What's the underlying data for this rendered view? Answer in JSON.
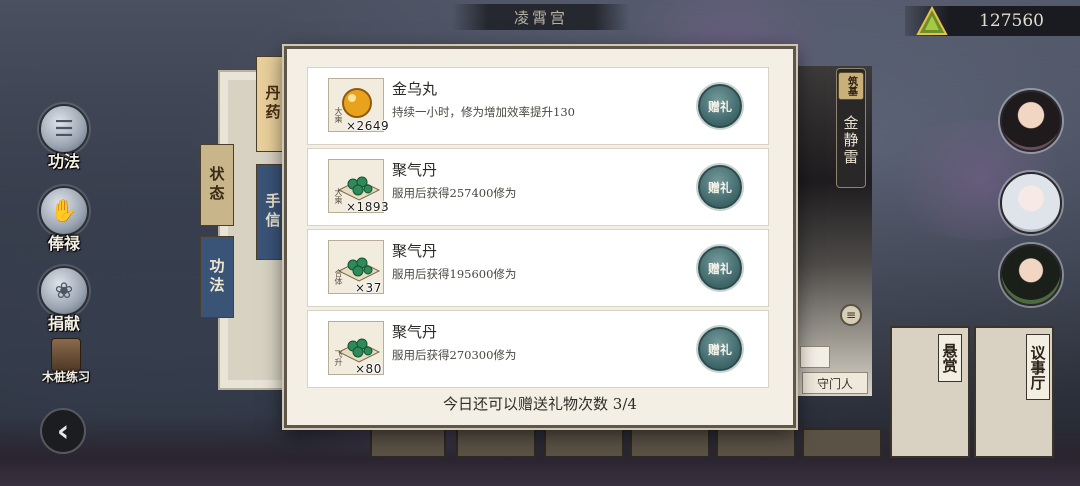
{
  "location": {
    "title": "凌霄宫"
  },
  "currency": {
    "amount": "127560",
    "icon": "jade-currency-icon"
  },
  "left_menu": [
    {
      "label": "功法",
      "icon": "scroll-icon"
    },
    {
      "label": "俸禄",
      "icon": "salary-hand-icon"
    },
    {
      "label": "捐献",
      "icon": "donate-bag-icon"
    }
  ],
  "wood_training": {
    "label": "木桩练习",
    "icon": "wooden-dummy-icon"
  },
  "back_button": {
    "glyph": "‹",
    "icon": "back-arrow-icon"
  },
  "side_tabs": {
    "pill_tab": "丹药",
    "letter_tab": "手信",
    "status_tab": "状态",
    "skill_tab": "功法"
  },
  "character": {
    "rank_badge": "筑基",
    "name": "金静雷",
    "guard_label": "守门人"
  },
  "boards": [
    {
      "title": "悬赏"
    },
    {
      "title": "议事厅"
    }
  ],
  "popup": {
    "gifts": [
      {
        "name": "金乌丸",
        "description": "持续一小时，修为增加效率提升130",
        "rank": "大乘",
        "count": "×2649",
        "icon": "golden-pill-icon",
        "button_label": "赠礼"
      },
      {
        "name": "聚气丹",
        "description": "服用后获得257400修为",
        "rank": "大乘",
        "count": "×1893",
        "icon": "green-pills-icon",
        "button_label": "赠礼"
      },
      {
        "name": "聚气丹",
        "description": "服用后获得195600修为",
        "rank": "合体",
        "count": "×37",
        "icon": "green-pills-icon",
        "button_label": "赠礼"
      },
      {
        "name": "聚气丹",
        "description": "服用后获得270300修为",
        "rank": "飞升",
        "count": "×80",
        "icon": "green-pills-icon",
        "button_label": "赠礼"
      }
    ],
    "footer": "今日还可以赠送礼物次数 3/4"
  },
  "colors": {
    "gift_button": "#4a7375",
    "popup_bg": "#f3efe5",
    "pill_tab": "#e8cf9c",
    "letter_tab": "#3a5478"
  }
}
